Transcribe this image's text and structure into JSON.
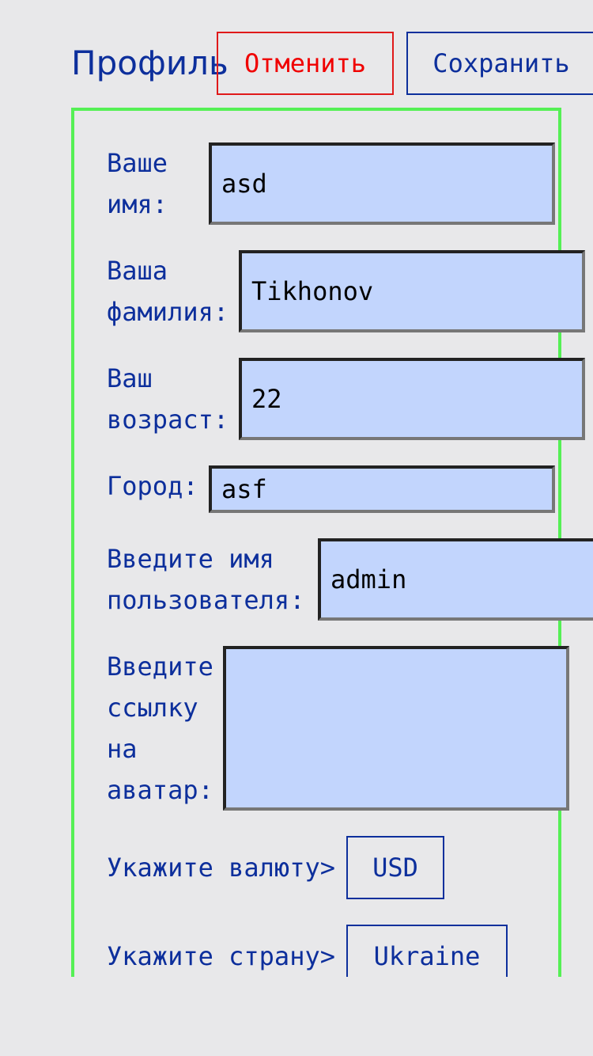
{
  "header": {
    "title": "Профиль",
    "cancel_label": "Отменить",
    "save_label": "Сохранить"
  },
  "form": {
    "first_name": {
      "label_line1": "Ваше",
      "label_line2": "имя:",
      "value": "asd"
    },
    "last_name": {
      "label_line1": "Ваша",
      "label_line2": "фамилия:",
      "value": "Tikhonov"
    },
    "age": {
      "label_line1": "Ваш",
      "label_line2": "возраст:",
      "value": "22"
    },
    "city": {
      "label": "Город:",
      "value": "asf"
    },
    "username": {
      "label_line1": "Введите имя",
      "label_line2": "пользователя:",
      "value": "admin"
    },
    "avatar": {
      "label_line1": "Введите",
      "label_line2": "ссылку",
      "label_line3": "на",
      "label_line4": "аватар:",
      "value": ""
    },
    "currency": {
      "label": "Укажите валюту>",
      "value": "USD"
    },
    "country": {
      "label": "Укажите страну>",
      "value": "Ukraine"
    }
  },
  "colors": {
    "text_blue": "#0d2f9c",
    "cancel_red": "#f00000",
    "frame_green": "#55f055",
    "field_bg": "#c2d5fd",
    "page_bg": "#e8e8ea"
  }
}
